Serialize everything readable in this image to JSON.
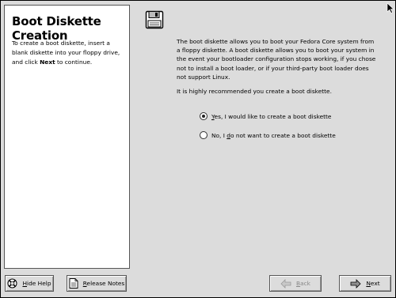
{
  "help": {
    "title": "Boot Diskette Creation",
    "text_before": "To create a boot diskette, insert a blank diskette into your floppy drive, and click ",
    "text_bold": "Next",
    "text_after": " to continue."
  },
  "main": {
    "intro": "The boot diskette allows you to boot your Fedora Core system from a floppy diskette.  A boot diskette allows you to boot your system in the event your bootloader configuration stops working, if you chose not to install a boot loader, or if your third-party boot loader does not support Linux.",
    "recommendation": "It is highly recommended you create a boot diskette.",
    "options": [
      {
        "mnemonic": "Y",
        "rest": "es, I would like to create a boot diskette",
        "selected": true
      },
      {
        "pre": "No, I ",
        "mnemonic": "d",
        "rest": "o not want to create a boot diskette",
        "selected": false
      }
    ]
  },
  "buttons": {
    "hide_help": {
      "mnemonic": "H",
      "rest": "ide Help"
    },
    "release_notes": {
      "mnemonic": "R",
      "rest": "elease Notes"
    },
    "back": {
      "mnemonic": "B",
      "rest": "ack",
      "enabled": false
    },
    "next": {
      "mnemonic": "N",
      "rest": "ext",
      "enabled": true
    }
  },
  "icons": {
    "diskette": "floppy-disk-icon",
    "hide_help": "lifebuoy-icon",
    "release_notes": "document-icon",
    "back": "left-arrow-icon",
    "next": "right-arrow-icon",
    "cursor": "mouse-pointer-icon"
  }
}
